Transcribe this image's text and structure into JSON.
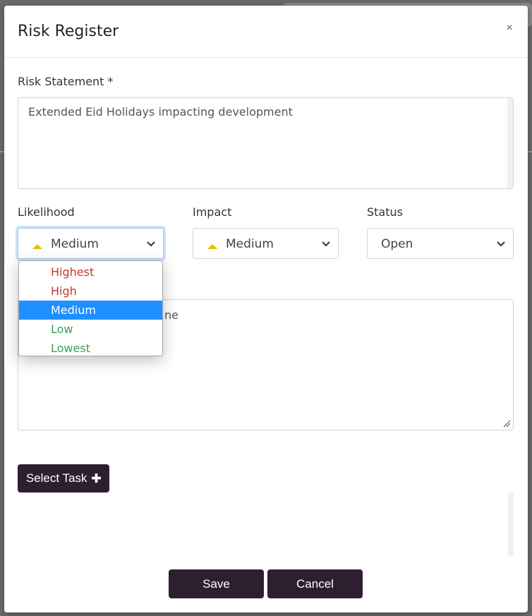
{
  "modal": {
    "title": "Risk Register",
    "close_label": "×"
  },
  "risk_statement": {
    "label": "Risk Statement *",
    "value": "Extended Eid Holidays impacting development"
  },
  "likelihood": {
    "label": "Likelihood",
    "selected": "Medium",
    "icon": "medium-priority-icon",
    "options": [
      {
        "label": "Highest",
        "color": "#c0392b"
      },
      {
        "label": "High",
        "color": "#c0392b"
      },
      {
        "label": "Medium",
        "color": "#ffffff"
      },
      {
        "label": "Low",
        "color": "#3aa05a"
      },
      {
        "label": "Lowest",
        "color": "#3aa05a"
      }
    ]
  },
  "impact": {
    "label": "Impact",
    "selected": "Medium",
    "icon": "medium-priority-icon"
  },
  "status": {
    "label": "Status",
    "selected": "Open"
  },
  "notes": {
    "partial_text": "ne"
  },
  "buttons": {
    "select_task": "Select Task",
    "select_task_icon": "plus-icon",
    "save": "Save",
    "cancel": "Cancel"
  },
  "colors": {
    "button_bg": "#2d1f30",
    "dropdown_selected": "#1e90ff",
    "priority_medium": "#e6c000",
    "priority_high": "#c0392b",
    "priority_low": "#3aa05a"
  }
}
